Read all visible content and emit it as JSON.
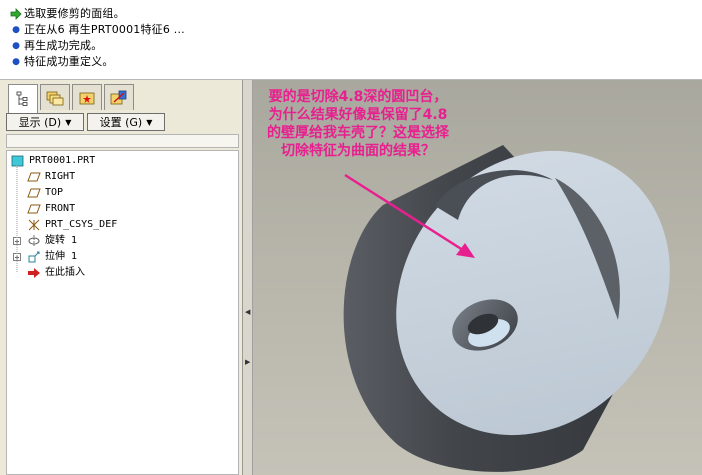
{
  "messages": [
    {
      "icon": "green-arrow-icon",
      "text": "选取要修剪的面组。"
    },
    {
      "icon": "bullet-icon",
      "text": "正在从6 再生PRT0001特征6 ..."
    },
    {
      "icon": "bullet-icon",
      "text": "再生成功完成。"
    },
    {
      "icon": "bullet-icon",
      "text": "特征成功重定义。"
    }
  ],
  "tabs": [
    {
      "name": "model-tree-tab",
      "icon": "tree-icon",
      "active": true
    },
    {
      "name": "folder-browser-tab",
      "icon": "folders-icon",
      "active": false
    },
    {
      "name": "favorites-tab",
      "icon": "favorites-icon",
      "active": false
    },
    {
      "name": "connections-tab",
      "icon": "connections-icon",
      "active": false
    }
  ],
  "buttons": {
    "display": "显示 (D)",
    "settings": "设置 (G)"
  },
  "tree": {
    "root": "PRT0001.PRT",
    "items": [
      {
        "label": "RIGHT",
        "icon": "datum-plane-icon",
        "expandable": false
      },
      {
        "label": "TOP",
        "icon": "datum-plane-icon",
        "expandable": false
      },
      {
        "label": "FRONT",
        "icon": "datum-plane-icon",
        "expandable": false
      },
      {
        "label": "PRT_CSYS_DEF",
        "icon": "csys-icon",
        "expandable": false
      },
      {
        "label": "旋转 1",
        "icon": "revolve-icon",
        "expandable": true
      },
      {
        "label": "拉伸 1",
        "icon": "extrude-icon",
        "expandable": true
      },
      {
        "label": "在此插入",
        "icon": "insert-here-arrow-icon",
        "expandable": false
      }
    ]
  },
  "annotation": {
    "text": "要的是切除4.8深的圆凹台，为什么结果好像是保留了4.8的壁厚给我车壳了？这是选择切除特征为曲面的结果？",
    "color": "#e8208f"
  },
  "colors": {
    "panel_bg": "#ece9d8",
    "viewport_bg": "#b5b3a8",
    "model_light": "#c5d0dc",
    "model_dark": "#4a4e54",
    "accent_arrow": "#e8208f"
  }
}
